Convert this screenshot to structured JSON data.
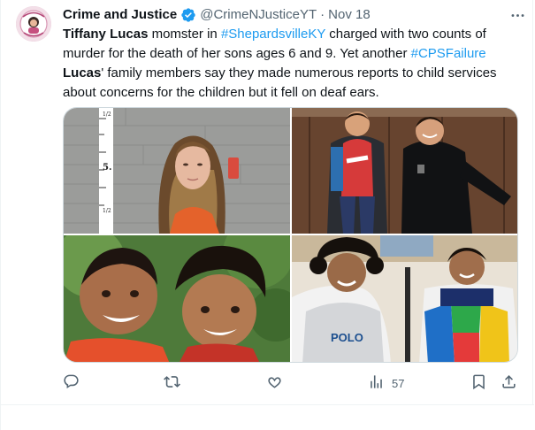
{
  "author": {
    "display_name": "Crime and Justice",
    "handle": "@CrimeNJusticeYT",
    "separator": "·",
    "date": "Nov 18",
    "avatar_icon": "pink-circle-portrait-avatar",
    "verified_icon": "verified-badge-icon",
    "verified_color": "#1d9bf0"
  },
  "tweet": {
    "segments": [
      {
        "text": "Tiffany Lucas",
        "style": "bold"
      },
      {
        "text": " momster in ",
        "style": "plain"
      },
      {
        "text": "#ShepardsvilleKY",
        "style": "tag"
      },
      {
        "text": " charged with two counts of murder for the death of her sons ages 6 and 9. Yet another ",
        "style": "plain"
      },
      {
        "text": "#CPSFailure",
        "style": "tag"
      },
      {
        "text": " ",
        "style": "plain"
      },
      {
        "text": "Lucas",
        "style": "bold"
      },
      {
        "text": "' family members say they made numerous reports to child services about concerns for the children but it fell on deaf ears.",
        "style": "plain"
      }
    ]
  },
  "media": {
    "images": [
      {
        "name": "mugshot-photo",
        "marks": {
          "top": "1/2",
          "middle": "5.",
          "bottom": "1/2"
        }
      },
      {
        "name": "two-boys-jackets-photo"
      },
      {
        "name": "two-boys-closeup-photo"
      },
      {
        "name": "two-boys-sweaters-photo",
        "sweater_text": "POLO"
      }
    ]
  },
  "actions": {
    "reply_icon": "reply-icon",
    "retweet_icon": "retweet-icon",
    "like_icon": "heart-icon",
    "views_icon": "views-bar-chart-icon",
    "views_count": "57",
    "bookmark_icon": "bookmark-icon",
    "share_icon": "share-icon"
  },
  "colors": {
    "text_primary": "#0f1419",
    "text_secondary": "#536471",
    "link": "#1d9bf0",
    "border": "#cfd9de"
  }
}
